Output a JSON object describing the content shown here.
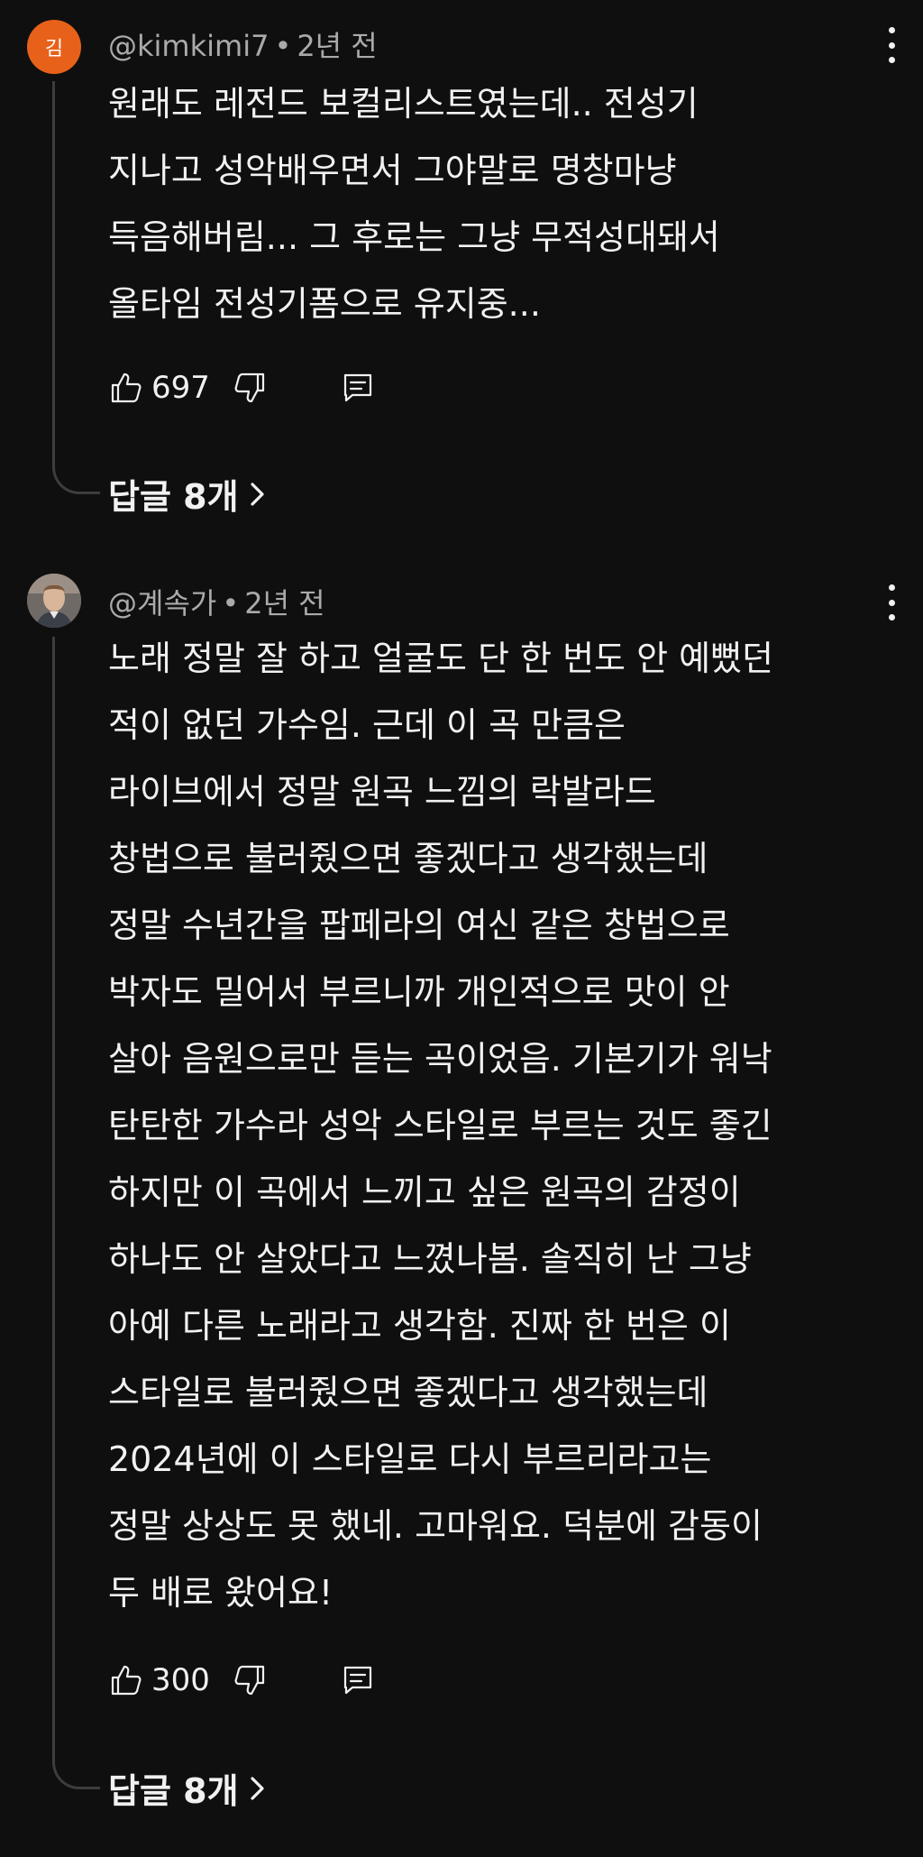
{
  "comments": [
    {
      "avatar_letter": "김",
      "avatar_color": "#e8611a",
      "handle": "@kimkimi7",
      "separator": "•",
      "time": "2년 전",
      "lines": [
        "원래도 레전드 보컬리스트였는데.. 전성기",
        "지나고 성악배우면서 그야말로 명창마냥",
        "득음해버림... 그 후로는 그냥 무적성대돼서",
        "올타임 전성기폼으로 유지중..."
      ],
      "likes": "697",
      "replies_label": "답글 8개"
    },
    {
      "avatar_icon": "user-photo",
      "handle": "@계속가",
      "separator": "•",
      "time": "2년 전",
      "lines": [
        "노래 정말 잘 하고 얼굴도 단 한 번도 안 예뻤던",
        "적이 없던 가수임. 근데 이 곡 만큼은",
        "라이브에서 정말 원곡 느낌의 락발라드",
        "창법으로 불러줬으면 좋겠다고 생각했는데",
        "정말 수년간을 팝페라의 여신 같은 창법으로",
        "박자도 밀어서 부르니까 개인적으로 맛이 안",
        "살아 음원으로만 듣는 곡이었음. 기본기가 워낙",
        "탄탄한 가수라 성악 스타일로 부르는 것도 좋긴",
        "하지만 이 곡에서 느끼고 싶은 원곡의 감정이",
        "하나도 안 살았다고 느꼈나봄. 솔직히 난 그냥",
        "아예 다른 노래라고 생각함. 진짜 한 번은 이",
        "스타일로 불러줬으면 좋겠다고 생각했는데",
        "2024년에 이 스타일로 다시 부르리라고는",
        "정말 상상도 못 했네. 고마워요. 덕분에 감동이",
        "두 배로 왔어요!"
      ],
      "likes": "300",
      "replies_label": "답글 8개"
    }
  ]
}
